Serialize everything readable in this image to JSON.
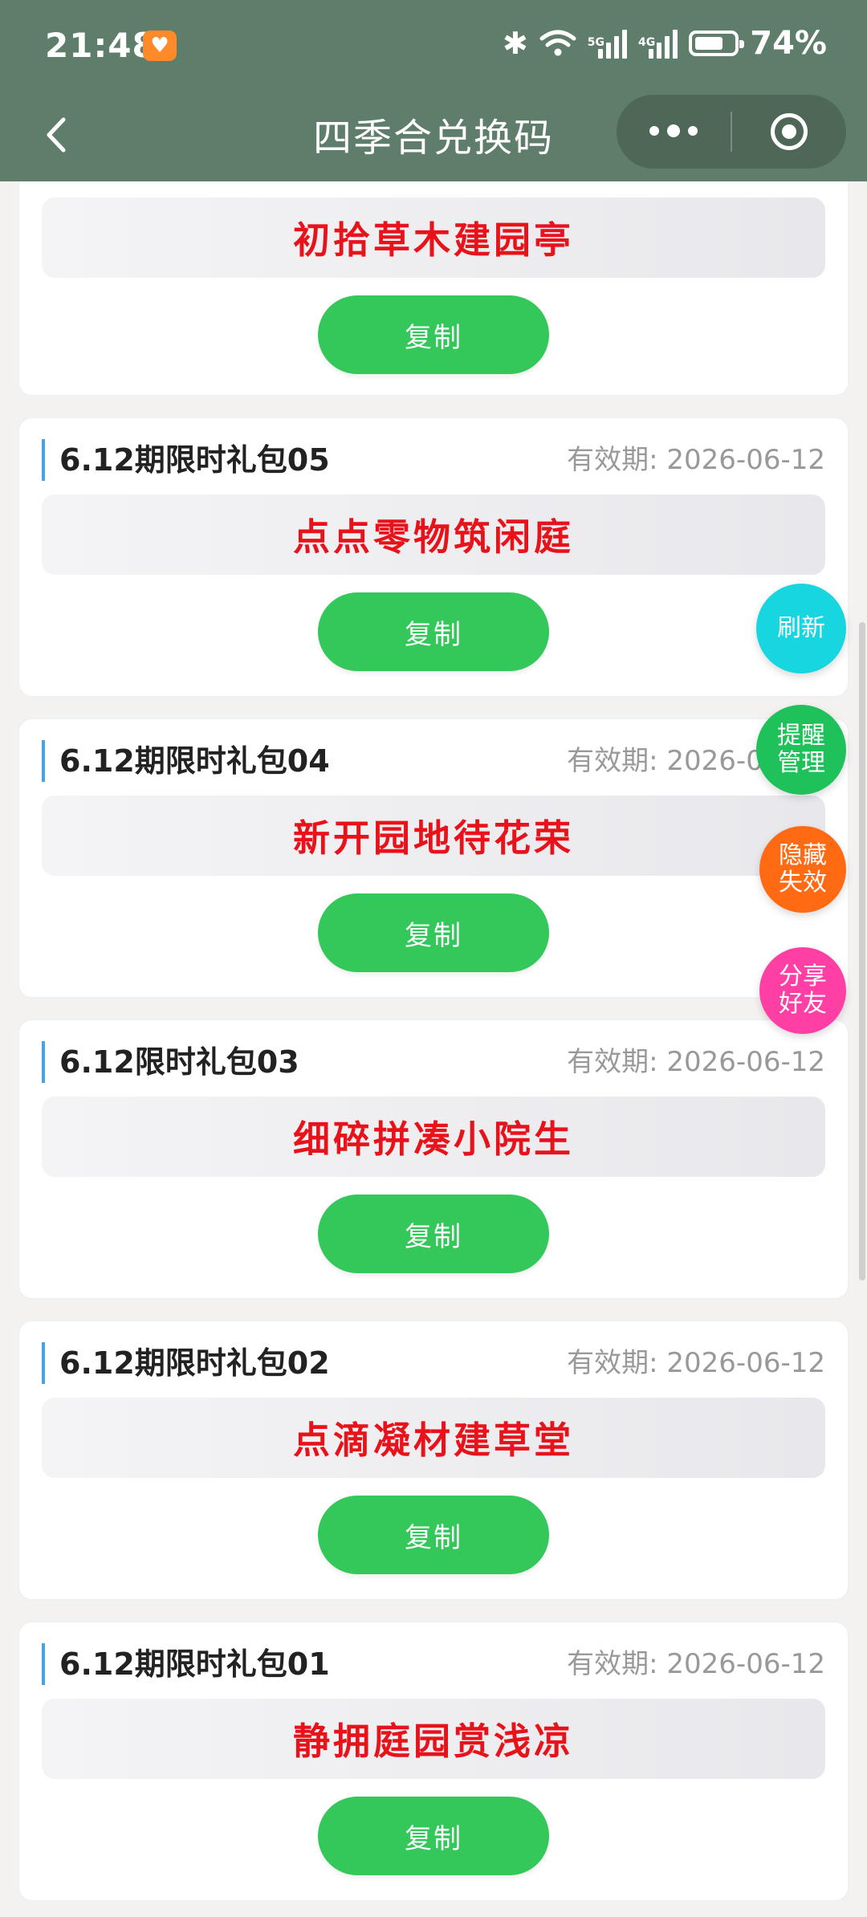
{
  "status_bar": {
    "time": "21:48",
    "network_5g": "5G",
    "network_4g": "4G",
    "battery": "74%",
    "battery_level": 0.74
  },
  "nav": {
    "title": "四季合兑换码"
  },
  "cards": [
    {
      "name": "",
      "valid": "",
      "code": "初拾草木建园亭",
      "copy_label": "复制"
    },
    {
      "name": "6.12期限时礼包05",
      "valid": "有效期: 2026-06-12",
      "code": "点点零物筑闲庭",
      "copy_label": "复制"
    },
    {
      "name": "6.12期限时礼包04",
      "valid": "有效期: 2026-06-12",
      "code": "新开园地待花荣",
      "copy_label": "复制"
    },
    {
      "name": "6.12限时礼包03",
      "valid": "有效期: 2026-06-12",
      "code": "细碎拼凑小院生",
      "copy_label": "复制"
    },
    {
      "name": "6.12期限时礼包02",
      "valid": "有效期: 2026-06-12",
      "code": "点滴凝材建草堂",
      "copy_label": "复制"
    },
    {
      "name": "6.12期限时礼包01",
      "valid": "有效期: 2026-06-12",
      "code": "静拥庭园赏浅凉",
      "copy_label": "复制"
    }
  ],
  "floating": {
    "refresh": "刷新",
    "reminder_1": "提醒",
    "reminder_2": "管理",
    "hide_1": "隐藏",
    "hide_2": "失效",
    "share_1": "分享",
    "share_2": "好友"
  },
  "colors": {
    "nav_bg": "#5f7d6b",
    "code_red": "#e8131a",
    "copy_green": "#34c759",
    "refresh_cyan": "#17d6e0",
    "reminder_green": "#1fc15a",
    "hide_orange": "#ff6a13",
    "share_pink": "#ff3fa4"
  }
}
